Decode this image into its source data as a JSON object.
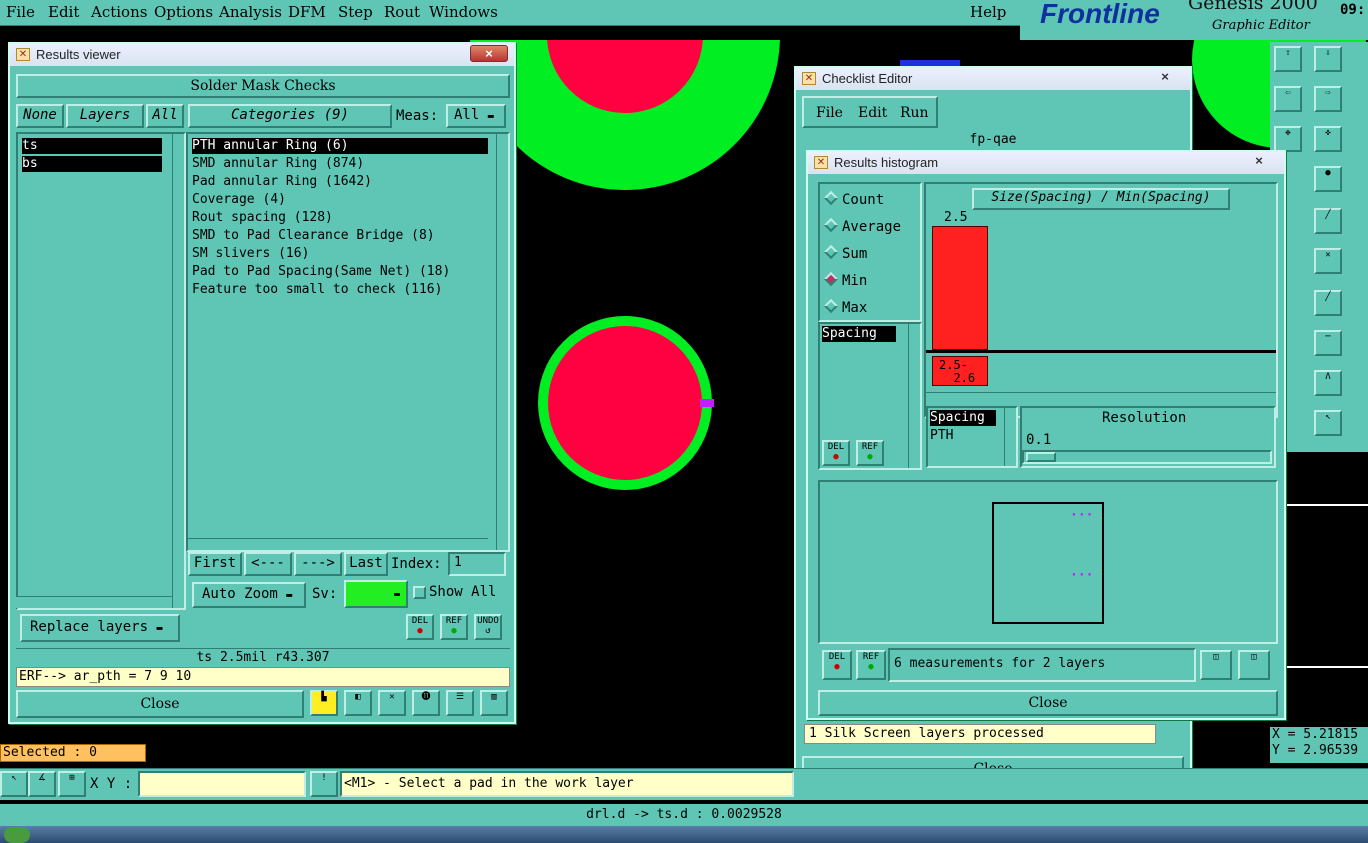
{
  "menu": {
    "items": [
      "File",
      "Edit",
      "Actions",
      "Options",
      "Analysis",
      "DFM",
      "Step",
      "Rout",
      "Windows"
    ],
    "help": "Help"
  },
  "logo": {
    "brand": "Frontline",
    "product": "Genesis 2000",
    "subtitle": "Graphic Editor",
    "time": "09:"
  },
  "results_viewer": {
    "title": "Results viewer",
    "close_x": "×",
    "header": "Solder Mask Checks",
    "layer_buttons": {
      "none": "None",
      "layers": "Layers",
      "all": "All"
    },
    "layers": [
      "ts",
      "bs"
    ],
    "categories_label": "Categories (9)",
    "meas_label": "Meas:",
    "meas_value": "All",
    "categories": [
      "PTH annular Ring (6)",
      "SMD annular Ring (874)",
      "Pad annular Ring (1642)",
      "Coverage (4)",
      "Rout spacing (128)",
      "SMD to Pad Clearance Bridge (8)",
      "SM slivers (16)",
      "Pad to Pad Spacing(Same Net) (18)",
      "Feature too small to check (116)"
    ],
    "nav": {
      "first": "First",
      "prev": "<---",
      "next": "--->",
      "last": "Last",
      "index_label": "Index:",
      "index_value": "1"
    },
    "auto_zoom": "Auto Zoom",
    "sv_label": "Sv:",
    "show_all": "Show All",
    "replace_layers": "Replace layers",
    "small_btns": {
      "del": "DEL",
      "ref": "REF",
      "undo": "UNDO"
    },
    "status": "ts 2.5mil  r43.307",
    "erf_line": "ERF--> ar_pth = 7 9 10",
    "close": "Close"
  },
  "checklist_editor": {
    "title": "Checklist Editor",
    "close_x": "×",
    "menu": [
      "File",
      "Edit",
      "Run"
    ],
    "name": "fp-qae",
    "status_line": "1 Silk Screen layers processed",
    "close": "Close"
  },
  "histogram": {
    "title": "Results histogram",
    "close_x": "×",
    "modes": [
      {
        "label": "Count",
        "on": false
      },
      {
        "label": "Average",
        "on": false
      },
      {
        "label": "Sum",
        "on": false
      },
      {
        "label": "Min",
        "on": true
      },
      {
        "label": "Max",
        "on": false
      }
    ],
    "measure_list": [
      "Spacing"
    ],
    "chart_title": "Size(Spacing) / Min(Spacing)",
    "bar_value": "2.5",
    "bar_range": "2.5-\n  2.6",
    "bar_color": "#ff2020",
    "spacing_list": [
      "Spacing",
      "PTH"
    ],
    "resolution_label": "Resolution",
    "resolution_value": "0.1",
    "del": "DEL",
    "ref": "REF",
    "measurements": "6 measurements for 2 layers",
    "close": "Close"
  },
  "selected": "Selected : 0",
  "xy_label": "X Y :",
  "xy_value": "",
  "prompt": "<M1> - Select a pad in the work layer",
  "coords": {
    "x": "X = 5.21815",
    "y": "Y = 2.96539"
  },
  "bottom_status": "drl.d -> ts.d : 0.0029528",
  "colors": {
    "panel": "#5fc6b6",
    "pad": "#ff0040",
    "ring": "#00ff20",
    "selection": "#c020ff"
  }
}
